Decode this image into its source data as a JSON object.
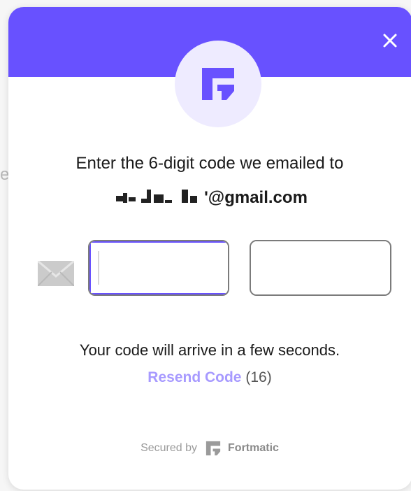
{
  "backdrop": {
    "edge_char": "e"
  },
  "dialog": {
    "close_label": "×",
    "prompt": "Enter the 6-digit code we emailed to",
    "email_suffix": "'@gmail.com",
    "code_slots": [
      "",
      "",
      "",
      "",
      "",
      ""
    ],
    "arrival_note": "Your code will arrive in a few seconds.",
    "resend_label": "Resend Code",
    "resend_countdown": "(16)",
    "footer": {
      "secured_by": "Secured by",
      "brand": "Fortmatic"
    }
  },
  "icons": {
    "close": "close-icon",
    "logo": "fortmatic-logo-icon",
    "mail": "envelope-icon",
    "footer_logo": "fortmatic-mini-logo-icon"
  },
  "colors": {
    "accent": "#6851ff",
    "logo_bg": "#eeebff",
    "resend_link": "#a79aff",
    "input_border": "#7b7b7b",
    "muted_text": "#9a9a9a"
  }
}
